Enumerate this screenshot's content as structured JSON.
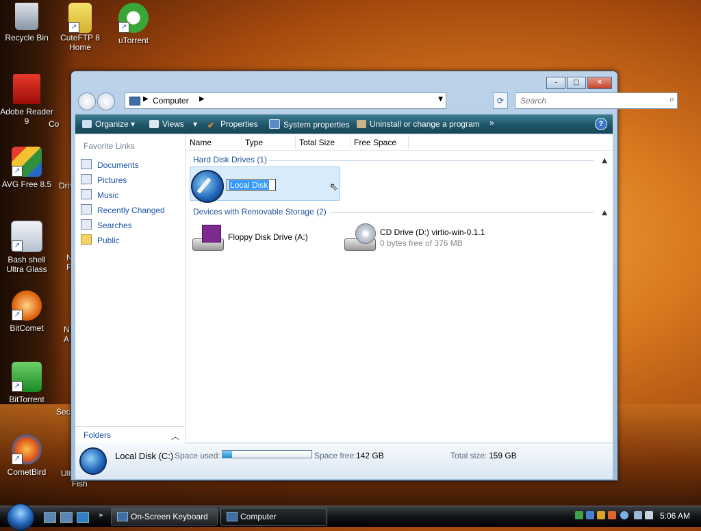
{
  "desktop": {
    "icons": [
      {
        "label": "Recycle Bin"
      },
      {
        "label": "CuteFTP 8\nHome"
      },
      {
        "label": "uTorrent"
      },
      {
        "label": "Adobe Reader\n9"
      },
      {
        "label": "AVG Free 8.5"
      },
      {
        "label": "Bash shell\nUltra Glass"
      },
      {
        "label": "BitComet"
      },
      {
        "label": "BitTorrent"
      },
      {
        "label": "CometBird"
      }
    ],
    "partial_labels": [
      "Co",
      "Driv",
      "N\nA",
      "N\nF",
      "Secu",
      "Ultr",
      "Fish"
    ]
  },
  "window": {
    "controls": {
      "minimize": "–",
      "maximize": "□",
      "close": "✕"
    },
    "address": {
      "location": "Computer"
    },
    "search": {
      "placeholder": "Search"
    },
    "toolbar": {
      "organize": "Organize",
      "views": "Views",
      "properties": "Properties",
      "system_properties": "System properties",
      "uninstall": "Uninstall or change a program",
      "more": "»",
      "help": "?"
    },
    "favorite_links": {
      "title": "Favorite Links",
      "items": [
        "Documents",
        "Pictures",
        "Music",
        "Recently Changed",
        "Searches",
        "Public"
      ]
    },
    "folders": "Folders",
    "columns": [
      "Name",
      "Type",
      "Total Size",
      "Free Space"
    ],
    "groups": {
      "hdd": "Hard Disk Drives (1)",
      "removable": "Devices with Removable Storage (2)"
    },
    "rename_value": "Local Disk",
    "devices": {
      "floppy": {
        "name": "Floppy Disk Drive (A:)"
      },
      "cd": {
        "name": "CD Drive (D:) virtio-win-0.1.1",
        "sub": "0 bytes free of 376 MB"
      }
    },
    "details": {
      "drive_name": "Local Disk (C:)",
      "space_used_label": "Space used:",
      "space_used_fraction": 0.107,
      "space_free_label": "Space free:",
      "space_free_value": "142 GB",
      "total_size_label": "Total size:",
      "total_size_value": "159 GB"
    }
  },
  "taskbar": {
    "tasks": [
      {
        "label": "On-Screen Keyboard"
      },
      {
        "label": "Computer"
      }
    ],
    "clock": "5:06 AM"
  }
}
